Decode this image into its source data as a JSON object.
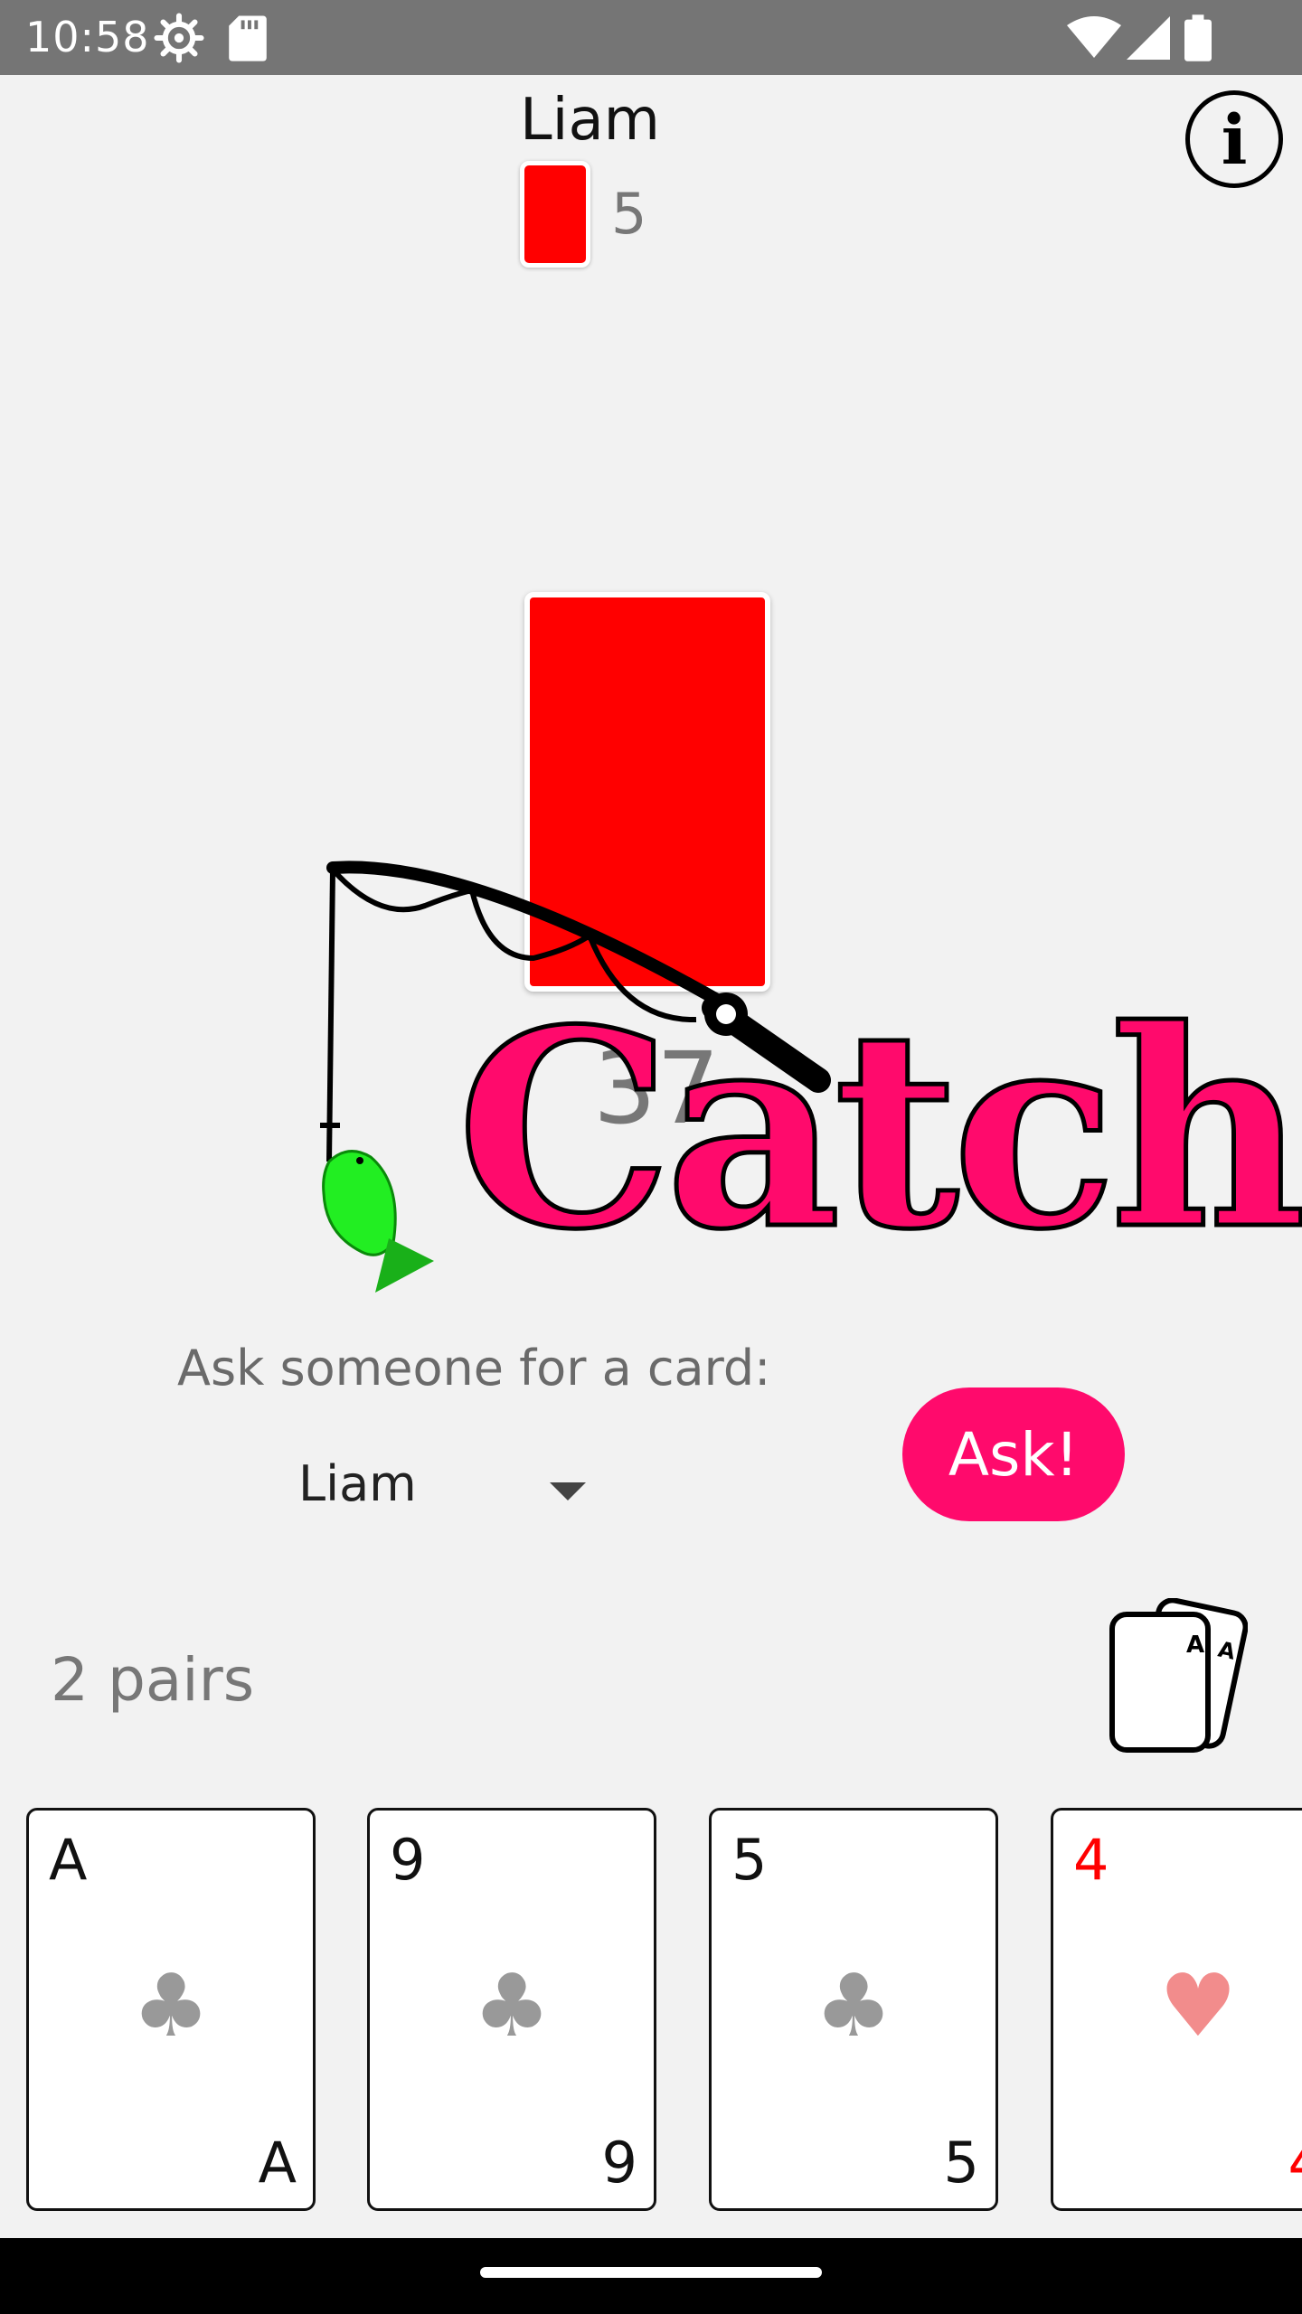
{
  "status_bar": {
    "time": "10:58",
    "icons": [
      "settings-gear-icon",
      "sd-card-icon",
      "wifi-icon",
      "signal-icon",
      "battery-icon"
    ]
  },
  "opponent": {
    "name": "Liam",
    "card_count": "5",
    "card_back_color": "#ff0000"
  },
  "deck": {
    "remaining": "37",
    "card_back_color": "#ff0000"
  },
  "logo": {
    "text": "Catch",
    "color": "#ff0a6c",
    "fish_color": "#22ee22"
  },
  "ask": {
    "label": "Ask someone for a card:",
    "selected_player": "Liam",
    "button_label": "Ask!",
    "button_color": "#ff0a6c"
  },
  "pairs": {
    "label": "2 pairs",
    "icon_rank": "A"
  },
  "hand": [
    {
      "rank": "A",
      "suit": "♣",
      "color": "#111111",
      "suit_color": "#999999"
    },
    {
      "rank": "9",
      "suit": "♣",
      "color": "#111111",
      "suit_color": "#999999"
    },
    {
      "rank": "5",
      "suit": "♣",
      "color": "#111111",
      "suit_color": "#999999"
    },
    {
      "rank": "4",
      "suit": "♥",
      "color": "#ff0000",
      "suit_color": "#f28c8c"
    }
  ]
}
